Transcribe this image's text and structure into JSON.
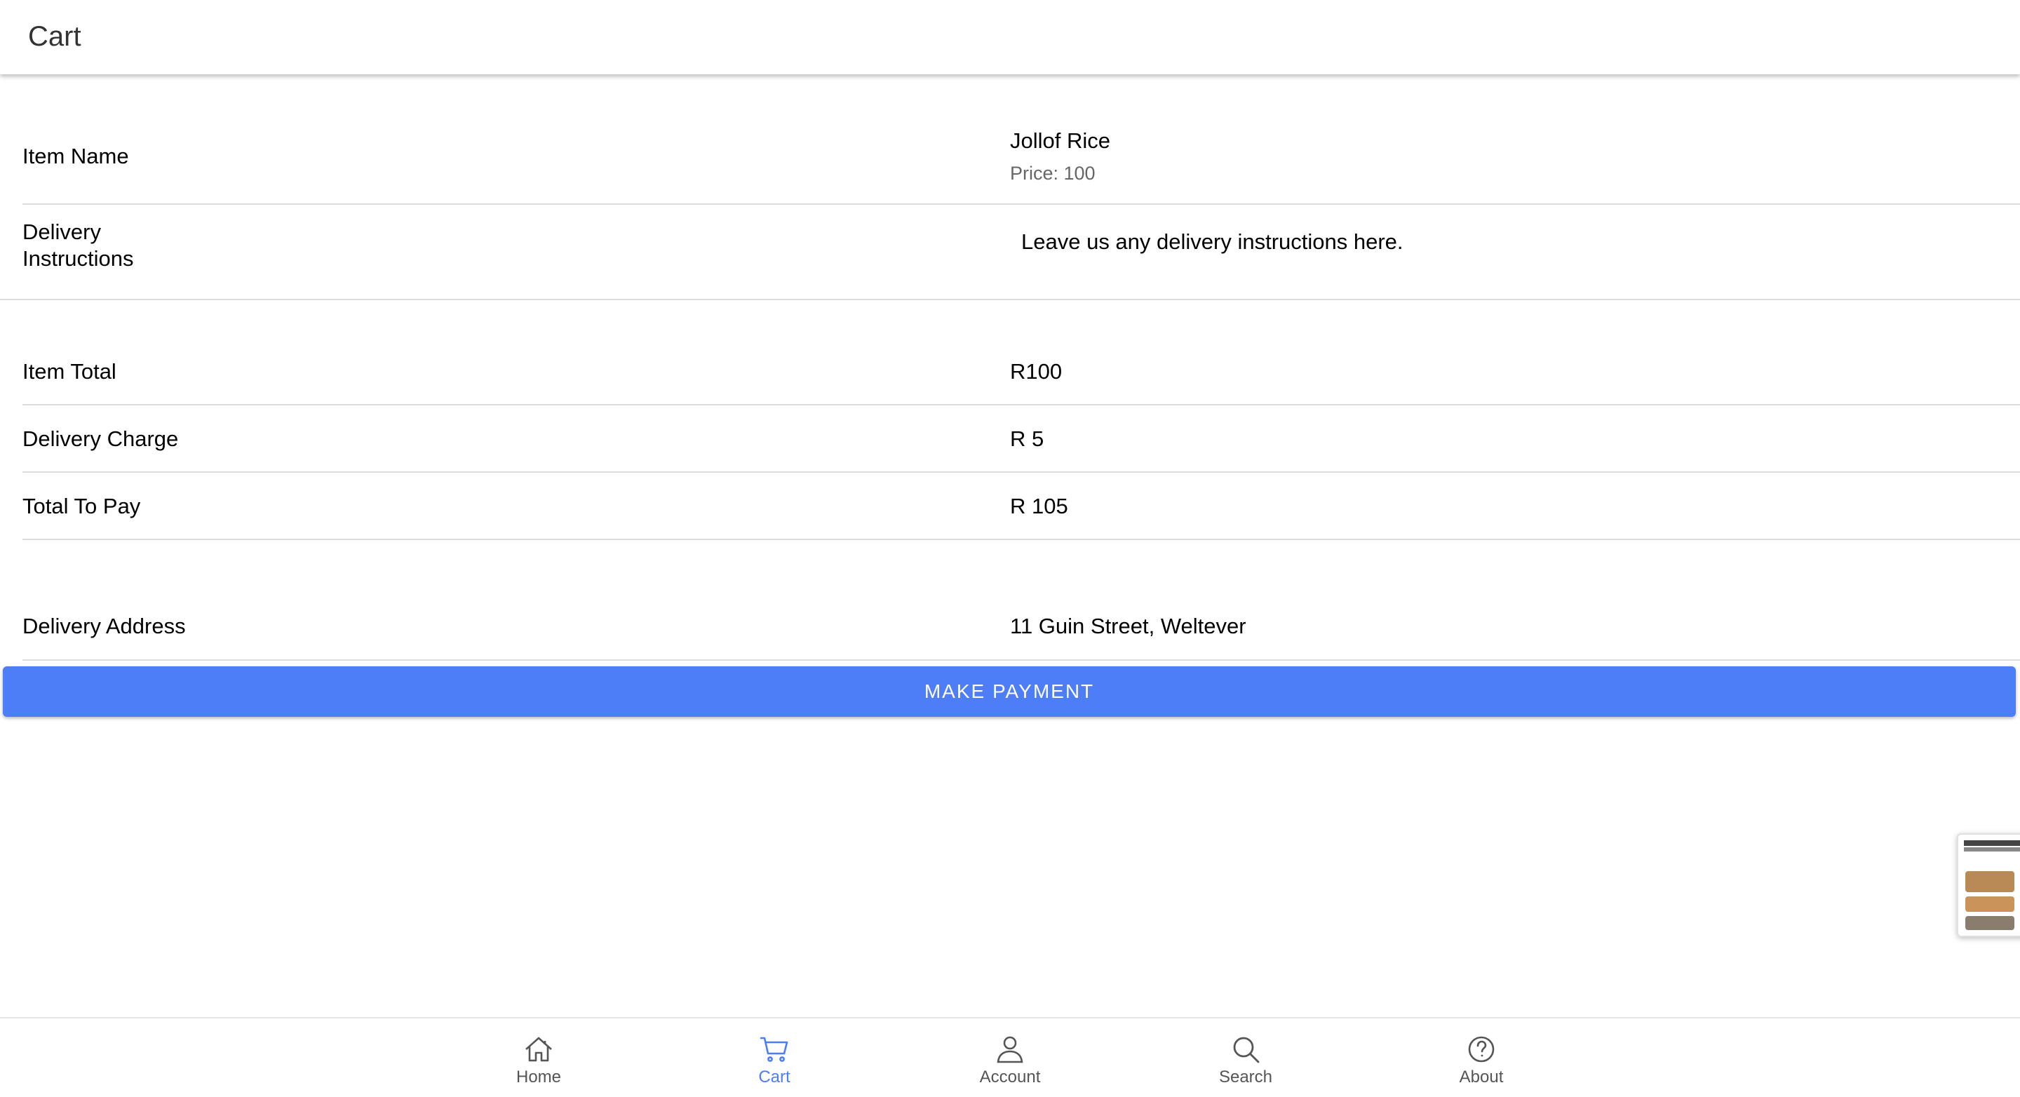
{
  "header": {
    "title": "Cart"
  },
  "item": {
    "label": "Item Name",
    "name": "Jollof Rice",
    "price_text": "Price: 100"
  },
  "delivery_instructions": {
    "label_line1": "Delivery",
    "label_line2": "Instructions",
    "placeholder": "Leave us any delivery instructions here."
  },
  "summary": {
    "item_total_label": "Item Total",
    "item_total_value": "R100",
    "delivery_charge_label": "Delivery Charge",
    "delivery_charge_value": "R 5",
    "total_label": "Total To Pay",
    "total_value": "R 105"
  },
  "address": {
    "label": "Delivery Address",
    "value": "11 Guin Street, Weltever"
  },
  "actions": {
    "make_payment": "MAKE PAYMENT"
  },
  "nav": {
    "items": [
      {
        "label": "Home",
        "icon": "home-icon",
        "active": false
      },
      {
        "label": "Cart",
        "icon": "cart-icon",
        "active": true
      },
      {
        "label": "Account",
        "icon": "person-icon",
        "active": false
      },
      {
        "label": "Search",
        "icon": "search-icon",
        "active": false
      },
      {
        "label": "About",
        "icon": "help-circle-icon",
        "active": false
      }
    ]
  },
  "colors": {
    "accent": "#4d7ef7",
    "divider": "#dcdcdc",
    "nav_inactive": "#555555"
  }
}
